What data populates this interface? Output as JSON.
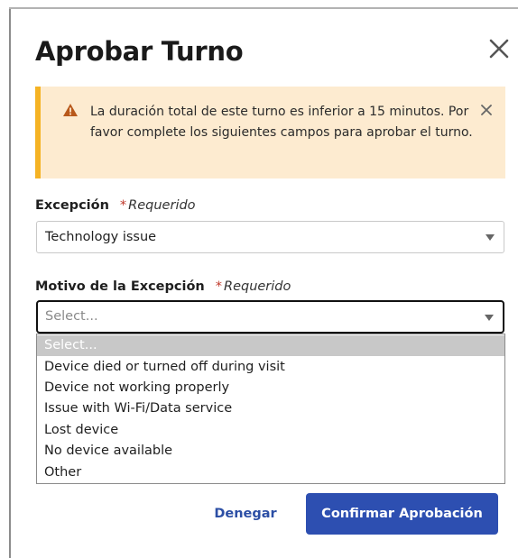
{
  "dialog": {
    "title": "Aprobar Turno",
    "close_icon": "close-icon"
  },
  "alert": {
    "icon": "warning-triangle-icon",
    "message": "La duración total de este turno es inferior a 15 minutos. Por favor complete los siguientes campos para aprobar el turno.",
    "close_icon": "close-icon",
    "colors": {
      "background": "#fdebd0",
      "accent": "#f5b324"
    }
  },
  "exception": {
    "label": "Excepción",
    "required_star": "*",
    "required_text": "Requerido",
    "value": "Technology issue"
  },
  "reason": {
    "label": "Motivo de la Excepción",
    "required_star": "*",
    "required_text": "Requerido",
    "placeholder": "Select...",
    "options": [
      "Select...",
      "Device died or turned off during visit",
      "Device not working properly",
      "Issue with Wi-Fi/Data service",
      "Lost device",
      "No device available",
      "Other"
    ],
    "highlighted_index": 0
  },
  "actions": {
    "deny_label": "Denegar",
    "confirm_label": "Confirmar Aprobación",
    "colors": {
      "primary": "#2d4fb1",
      "link": "#2c4fa5"
    }
  }
}
